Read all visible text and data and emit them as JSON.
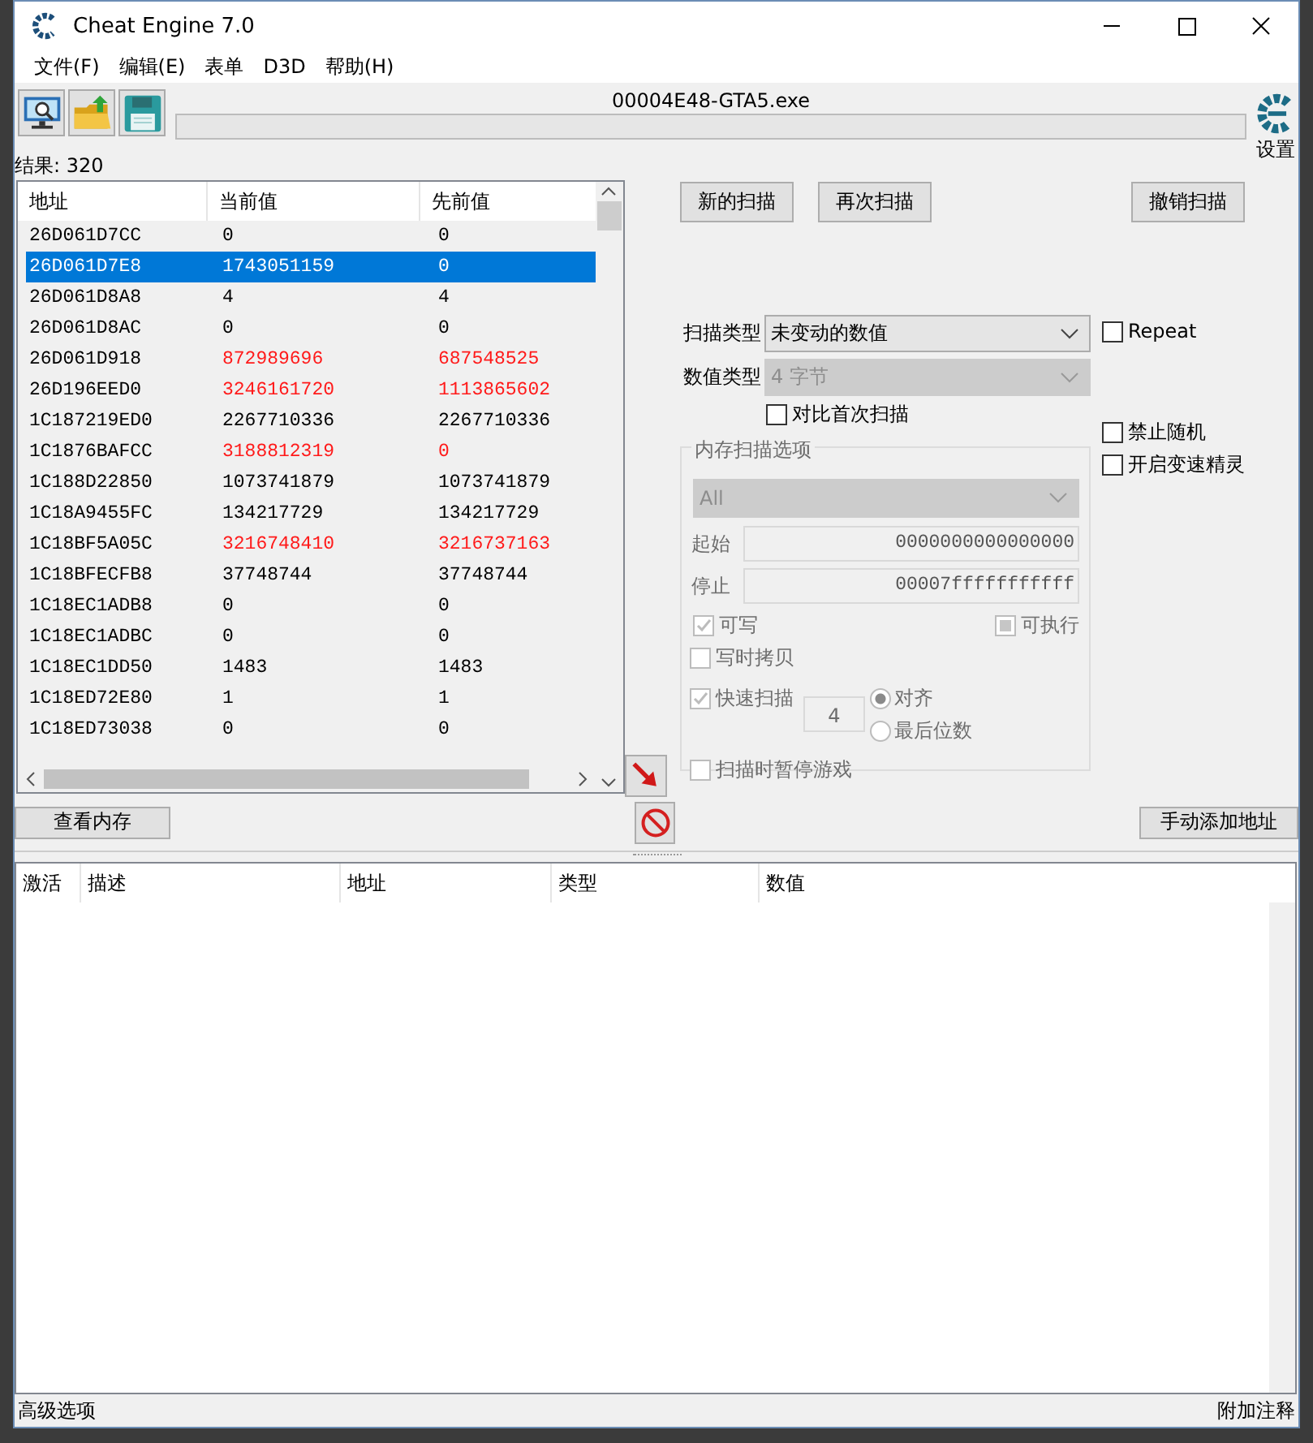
{
  "window": {
    "title": "Cheat Engine 7.0"
  },
  "menu": [
    {
      "label": "文件(F)"
    },
    {
      "label": "编辑(E)"
    },
    {
      "label": "表单"
    },
    {
      "label": "D3D"
    },
    {
      "label": "帮助(H)"
    }
  ],
  "process_name": "00004E48-GTA5.exe",
  "progress": {
    "level": 0
  },
  "settings_label": "设置",
  "results_label": "结果: 320",
  "scan_list": {
    "columns": [
      "地址",
      "当前值",
      "先前值"
    ],
    "rows": [
      {
        "address": "26D061D7CC",
        "current": "0",
        "previous": "0",
        "selected": false,
        "changed": false
      },
      {
        "address": "26D061D7E8",
        "current": "1743051159",
        "previous": "0",
        "selected": true,
        "changed": false
      },
      {
        "address": "26D061D8A8",
        "current": "4",
        "previous": "4",
        "selected": false,
        "changed": false
      },
      {
        "address": "26D061D8AC",
        "current": "0",
        "previous": "0",
        "selected": false,
        "changed": false
      },
      {
        "address": "26D061D918",
        "current": "872989696",
        "previous": "687548525",
        "selected": false,
        "changed": true
      },
      {
        "address": "26D196EED0",
        "current": "3246161720",
        "previous": "1113865602",
        "selected": false,
        "changed": true
      },
      {
        "address": "1C187219ED0",
        "current": "2267710336",
        "previous": "2267710336",
        "selected": false,
        "changed": false
      },
      {
        "address": "1C1876BAFCC",
        "current": "3188812319",
        "previous": "0",
        "selected": false,
        "changed": true
      },
      {
        "address": "1C188D22850",
        "current": "1073741879",
        "previous": "1073741879",
        "selected": false,
        "changed": false
      },
      {
        "address": "1C18A9455FC",
        "current": "134217729",
        "previous": "134217729",
        "selected": false,
        "changed": false
      },
      {
        "address": "1C18BF5A05C",
        "current": "3216748410",
        "previous": "3216737163",
        "selected": false,
        "changed": true
      },
      {
        "address": "1C18BFECFB8",
        "current": "37748744",
        "previous": "37748744",
        "selected": false,
        "changed": false
      },
      {
        "address": "1C18EC1ADB8",
        "current": "0",
        "previous": "0",
        "selected": false,
        "changed": false
      },
      {
        "address": "1C18EC1ADBC",
        "current": "0",
        "previous": "0",
        "selected": false,
        "changed": false
      },
      {
        "address": "1C18EC1DD50",
        "current": "1483",
        "previous": "1483",
        "selected": false,
        "changed": false
      },
      {
        "address": "1C18ED72E80",
        "current": "1",
        "previous": "1",
        "selected": false,
        "changed": false
      },
      {
        "address": "1C18ED73038",
        "current": "0",
        "previous": "0",
        "selected": false,
        "changed": false
      }
    ]
  },
  "scan_buttons": {
    "new_scan": "新的扫描",
    "next_scan": "再次扫描",
    "undo_scan": "撤销扫描"
  },
  "scan_type": {
    "label": "扫描类型",
    "value": "未变动的数值",
    "disabled": false
  },
  "value_type": {
    "label": "数值类型",
    "value": "4 字节",
    "disabled": true
  },
  "compare_first": {
    "label": "对比首次扫描",
    "checked": false
  },
  "side_options": [
    {
      "label": "Repeat",
      "checked": false
    },
    {
      "label": "禁止随机",
      "checked": false
    },
    {
      "label": "开启变速精灵",
      "checked": false
    }
  ],
  "memory_options": {
    "title": "内存扫描选项",
    "region": {
      "value": "All",
      "disabled": true
    },
    "start": {
      "label": "起始",
      "value": "0000000000000000"
    },
    "stop": {
      "label": "停止",
      "value": "00007fffffffffff"
    },
    "flags": [
      {
        "label": "可写",
        "checked": true,
        "indeterminate": false
      },
      {
        "label": "可执行",
        "checked": false,
        "indeterminate": true
      },
      {
        "label": "写时拷贝",
        "checked": false,
        "indeterminate": false
      }
    ],
    "fast_scan": {
      "label": "快速扫描",
      "checked": true,
      "value": "4"
    },
    "alignment": [
      {
        "label": "对齐",
        "selected": true
      },
      {
        "label": "最后位数",
        "selected": false
      }
    ],
    "pause": {
      "label": "扫描时暂停游戏",
      "checked": false
    }
  },
  "view_memory": "查看内存",
  "add_address": "手动添加地址",
  "address_table": {
    "columns": [
      "激活",
      "描述",
      "地址",
      "类型",
      "数值"
    ]
  },
  "status_bar": {
    "left": "高级选项",
    "right": "附加注释"
  }
}
